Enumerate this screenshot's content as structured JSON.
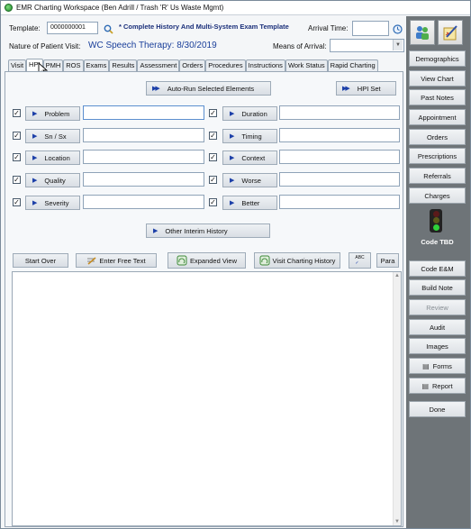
{
  "window": {
    "title": "EMR Charting Workspace (Ben Adrill / Trash 'R' Us Waste Mgmt)"
  },
  "header": {
    "template_label": "Template:",
    "template_value": "0000000001",
    "template_name": "* Complete History And Multi-System Exam Template",
    "arrival_time_label": "Arrival Time:",
    "arrival_time_value": "",
    "nature_label": "Nature of Patient Visit:",
    "nature_value": "WC Speech Therapy:  8/30/2019",
    "means_label": "Means of Arrival:",
    "means_value": ""
  },
  "tabs": [
    {
      "label": "Visit",
      "active": false
    },
    {
      "label": "HPI",
      "active": true
    },
    {
      "label": "PMH",
      "active": false
    },
    {
      "label": "ROS",
      "active": false
    },
    {
      "label": "Exams",
      "active": false
    },
    {
      "label": "Results",
      "active": false
    },
    {
      "label": "Assessment",
      "active": false
    },
    {
      "label": "Orders",
      "active": false
    },
    {
      "label": "Procedures",
      "active": false
    },
    {
      "label": "Instructions",
      "active": false
    },
    {
      "label": "Work Status",
      "active": false
    },
    {
      "label": "Rapid Charting",
      "active": false
    }
  ],
  "hpi": {
    "auto_run_label": "Auto-Run Selected Elements",
    "hpi_set_label": "HPI Set",
    "left_elements": [
      {
        "label": "Problem",
        "checked": true,
        "value": ""
      },
      {
        "label": "Sn / Sx",
        "checked": true,
        "value": ""
      },
      {
        "label": "Location",
        "checked": true,
        "value": ""
      },
      {
        "label": "Quality",
        "checked": true,
        "value": ""
      },
      {
        "label": "Severity",
        "checked": true,
        "value": ""
      }
    ],
    "right_elements": [
      {
        "label": "Duration",
        "checked": true,
        "value": ""
      },
      {
        "label": "Timing",
        "checked": true,
        "value": ""
      },
      {
        "label": "Context",
        "checked": true,
        "value": ""
      },
      {
        "label": "Worse",
        "checked": true,
        "value": ""
      },
      {
        "label": "Better",
        "checked": true,
        "value": ""
      }
    ],
    "other_interim_label": "Other Interim History"
  },
  "toolbar": {
    "start_over": "Start Over",
    "enter_free_text": "Enter Free Text",
    "expanded_view": "Expanded View",
    "visit_charting_history": "Visit Charting History",
    "abc": "ABC",
    "para": "Para"
  },
  "notes_text": "",
  "sidebar": {
    "buttons": [
      {
        "label": "Demographics",
        "enabled": true
      },
      {
        "label": "View Chart",
        "enabled": true
      },
      {
        "label": "Past Notes",
        "enabled": true
      },
      {
        "label": "Appointment",
        "enabled": true
      },
      {
        "label": "Orders",
        "enabled": true
      },
      {
        "label": "Prescriptions",
        "enabled": true
      },
      {
        "label": "Referrals",
        "enabled": true
      },
      {
        "label": "Charges",
        "enabled": true
      }
    ],
    "code_status": "Code TBD",
    "lower_buttons": [
      {
        "label": "Code E&M",
        "enabled": true
      },
      {
        "label": "Build Note",
        "enabled": true
      },
      {
        "label": "Review",
        "enabled": false
      },
      {
        "label": "Audit",
        "enabled": true
      },
      {
        "label": "Images",
        "enabled": true
      },
      {
        "label": "Forms",
        "enabled": true,
        "icon": "forms-icon"
      },
      {
        "label": "Report",
        "enabled": true,
        "icon": "report-icon"
      },
      {
        "label": "Done",
        "enabled": true
      }
    ]
  },
  "colors": {
    "accent_blue": "#1c3fa8",
    "sidebar_bg": "#6e7478",
    "traffic_red": "#5a1a1a",
    "traffic_yellow": "#5a5a1a",
    "traffic_green": "#2fd23a"
  }
}
